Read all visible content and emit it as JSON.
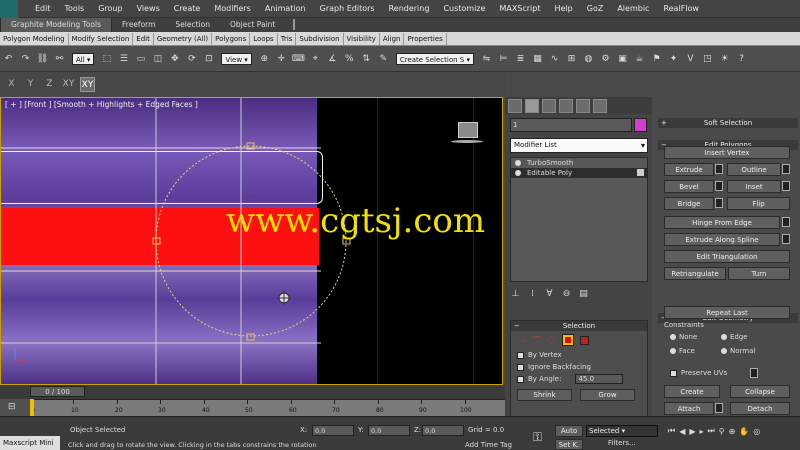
{
  "menubar": {
    "items": [
      "Edit",
      "Tools",
      "Group",
      "Views",
      "Create",
      "Modifiers",
      "Animation",
      "Graph Editors",
      "Rendering",
      "Customize",
      "MAXScript",
      "Help",
      "GoZ",
      "Alembic",
      "RealFlow"
    ]
  },
  "ribbon_tabs": [
    "Graphite Modeling Tools",
    "Freeform",
    "Selection",
    "Object Paint"
  ],
  "ribbon_panel": [
    "Polygon Modeling",
    "Modify Selection",
    "Edit",
    "Geometry (All)",
    "Polygons",
    "Loops",
    "Tris",
    "Subdivision",
    "Visibility",
    "Align",
    "Properties"
  ],
  "toolbar": {
    "filter_value": "All",
    "refcoord_value": "View",
    "named_selection_placeholder": "Create Selection S"
  },
  "axis": [
    "X",
    "Y",
    "Z",
    "XY",
    "XY"
  ],
  "viewport": {
    "label": "[ + ] [Front ] [Smooth + Highlights + Edged Faces ]",
    "watermark": "www.cgtsj.com"
  },
  "command_panel": {
    "object_name": "1",
    "modifier_list": "Modifier List",
    "stack": [
      {
        "label": "TurboSmooth",
        "selected": false
      },
      {
        "label": "Editable Poly",
        "selected": true
      }
    ],
    "selection": {
      "title": "Selection",
      "by_vertex": "By Vertex",
      "ignore_backfacing": "Ignore Backfacing",
      "by_angle": "By Angle:",
      "angle_value": "45.0",
      "shrink": "Shrink",
      "grow": "Grow"
    }
  },
  "edit_polygons": {
    "soft_selection": "Soft Selection",
    "title": "Edit Polygons",
    "insert_vertex": "Insert Vertex",
    "extrude": "Extrude",
    "outline": "Outline",
    "bevel": "Bevel",
    "inset": "Inset",
    "bridge": "Bridge",
    "flip": "Flip",
    "hinge": "Hinge From Edge",
    "extrude_spline": "Extrude Along Spline",
    "edit_tri": "Edit Triangulation",
    "retriangulate": "Retriangulate",
    "turn": "Turn",
    "edit_geometry": "Edit Geometry",
    "repeat_last": "Repeat Last",
    "constraints": "Constraints",
    "c_none": "None",
    "c_edge": "Edge",
    "c_face": "Face",
    "c_normal": "Normal",
    "preserve_uvs": "Preserve UVs",
    "create": "Create",
    "collapse": "Collapse",
    "attach": "Attach",
    "detach": "Detach"
  },
  "timeline": {
    "slider": "0 / 100",
    "ticks": [
      "0",
      "10",
      "20",
      "30",
      "40",
      "50",
      "60",
      "70",
      "80",
      "90",
      "100"
    ]
  },
  "status": {
    "maxscript": "Maxscript Mini",
    "selection": "Object Selected",
    "prompt": "Click and drag to rotate the view. Clicking in the tabs constrains the rotation",
    "x_label": "X:",
    "y_label": "Y:",
    "z_label": "Z:",
    "x_value": "0.0",
    "y_value": "0.0",
    "z_value": "0.0",
    "grid": "Grid = 0.0",
    "add_time_tag": "Add Time Tag",
    "auto": "Auto",
    "set_key": "Set K.",
    "selected": "Selected",
    "filters": "Filters..."
  }
}
